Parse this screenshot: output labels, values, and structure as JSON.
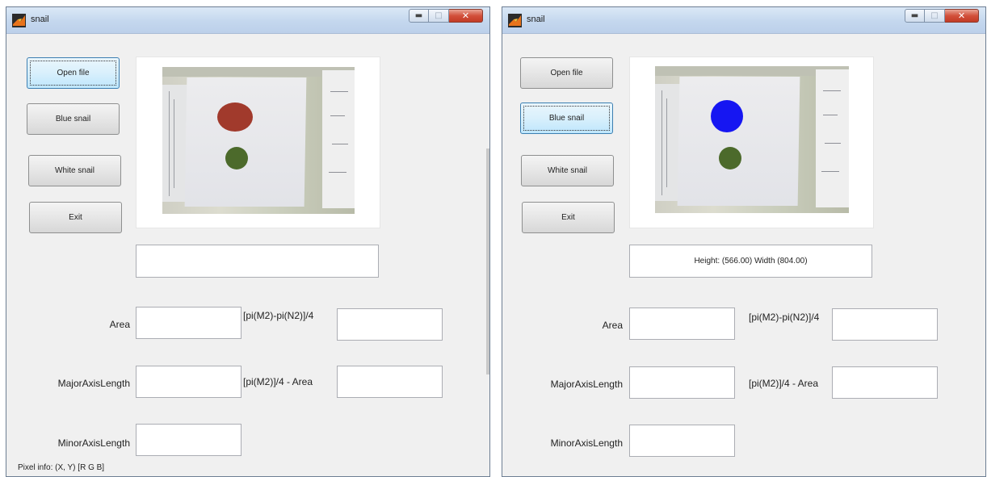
{
  "windows": [
    {
      "title": "snail",
      "buttons": {
        "open_file": "Open file",
        "blue_snail": "Blue snail",
        "white_snail": "White snail",
        "exit": "Exit"
      },
      "active_button": "open_file",
      "top_circle_color": "#a13a2c",
      "bottom_circle_color": "#4c6a2b",
      "info_text": "",
      "labels": {
        "area": "Area",
        "major": "MajorAxisLength",
        "minor": "MinorAxisLength",
        "formula1": "[pi(M2)-pi(N2)]/4",
        "formula2": "[pi(M2)]/4 - Area"
      },
      "pixel_info": "Pixel info: (X, Y)  [R G B]"
    },
    {
      "title": "snail",
      "buttons": {
        "open_file": "Open file",
        "blue_snail": "Blue snail",
        "white_snail": "White snail",
        "exit": "Exit"
      },
      "active_button": "blue_snail",
      "top_circle_color": "#1616f2",
      "bottom_circle_color": "#4c6a2b",
      "info_text": "Height: (566.00) Width (804.00)",
      "labels": {
        "area": "Area",
        "major": "MajorAxisLength",
        "minor": "MinorAxisLength",
        "formula1": "[pi(M2)-pi(N2)]/4",
        "formula2": "[pi(M2)]/4 - Area"
      },
      "pixel_info": ""
    }
  ]
}
